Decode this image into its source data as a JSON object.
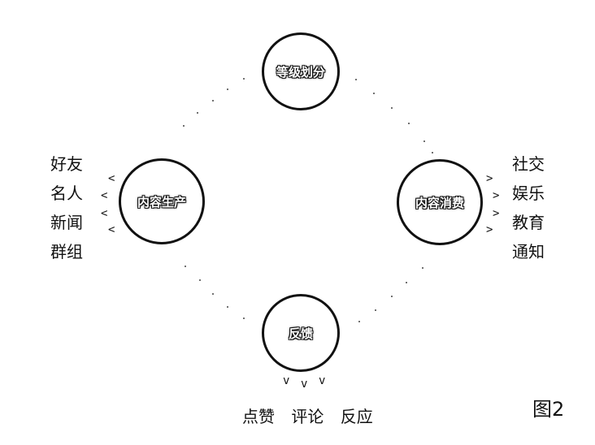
{
  "nodes": {
    "top": "等级划分",
    "left": "内容生产",
    "right": "内容消费",
    "bottom": "反馈"
  },
  "left_list": [
    "好友",
    "名人",
    "新闻",
    "群组"
  ],
  "right_list": [
    "社交",
    "娱乐",
    "教育",
    "通知"
  ],
  "bottom_list": [
    "点赞",
    "评论",
    "反应"
  ],
  "figure_label": "图2"
}
